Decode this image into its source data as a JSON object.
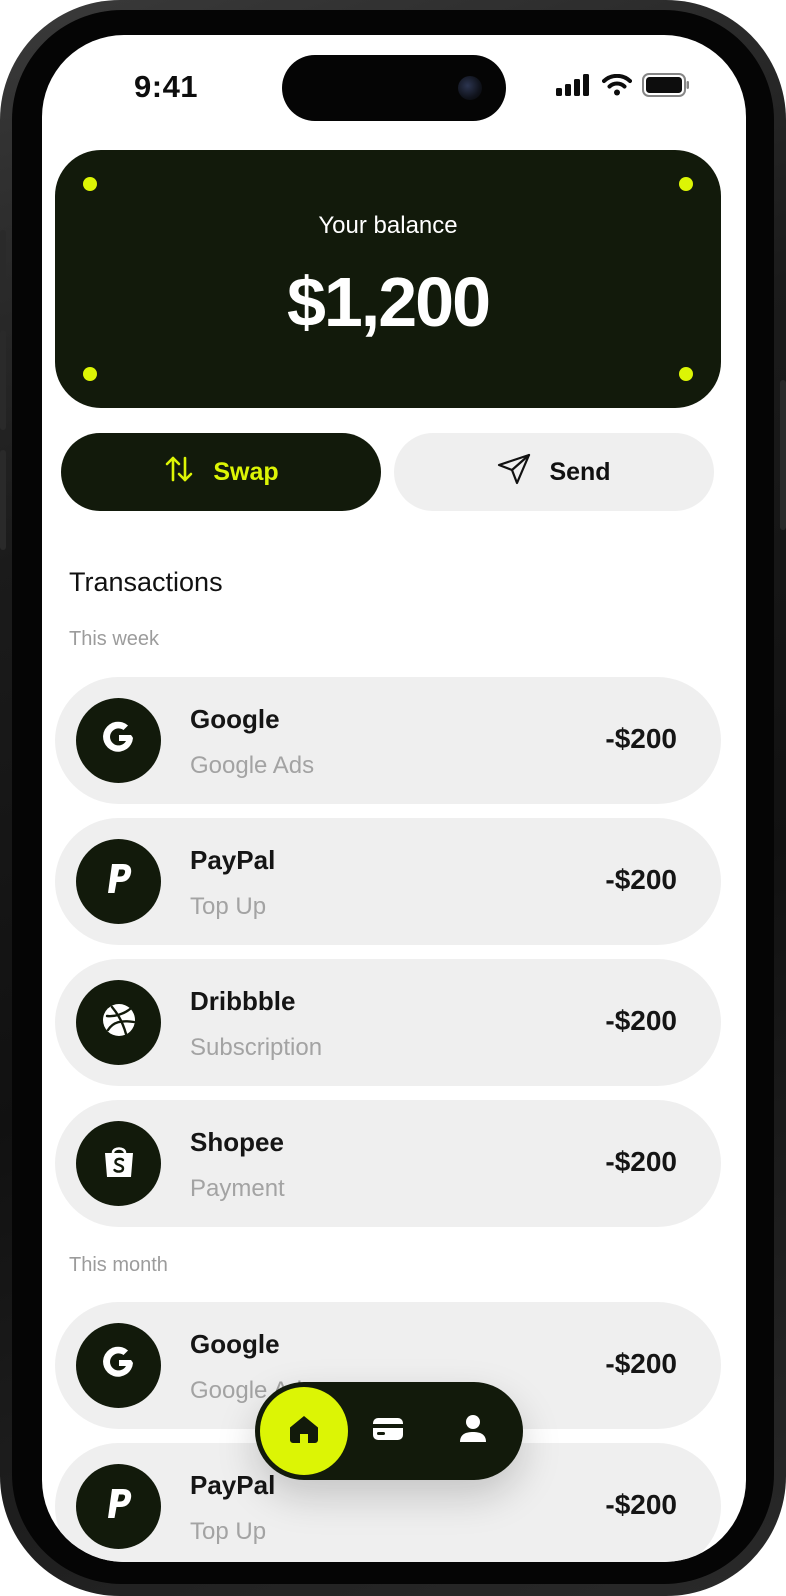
{
  "status_bar": {
    "time": "9:41"
  },
  "balance": {
    "label": "Your balance",
    "amount": "$1,200"
  },
  "actions": {
    "swap_label": "Swap",
    "send_label": "Send"
  },
  "transactions": {
    "title": "Transactions",
    "groups": [
      {
        "label": "This week",
        "items": [
          {
            "name": "Google",
            "subtitle": "Google Ads",
            "amount": "-$200",
            "icon": "google-icon"
          },
          {
            "name": "PayPal",
            "subtitle": "Top Up",
            "amount": "-$200",
            "icon": "paypal-icon"
          },
          {
            "name": "Dribbble",
            "subtitle": "Subscription",
            "amount": "-$200",
            "icon": "dribbble-icon"
          },
          {
            "name": "Shopee",
            "subtitle": "Payment",
            "amount": "-$200",
            "icon": "shopee-icon"
          }
        ]
      },
      {
        "label": "This month",
        "items": [
          {
            "name": "Google",
            "subtitle": "Google Ads",
            "amount": "-$200",
            "icon": "google-icon"
          },
          {
            "name": "PayPal",
            "subtitle": "Top Up",
            "amount": "-$200",
            "icon": "paypal-icon"
          }
        ]
      }
    ]
  },
  "bottom_nav": {
    "items": [
      {
        "icon": "home-icon",
        "active": true
      },
      {
        "icon": "card-icon",
        "active": false
      },
      {
        "icon": "profile-icon",
        "active": false
      }
    ]
  },
  "colors": {
    "accent": "#dcf505",
    "dark": "#121a0b",
    "surface": "#efefef",
    "muted": "#a3a3a3"
  }
}
